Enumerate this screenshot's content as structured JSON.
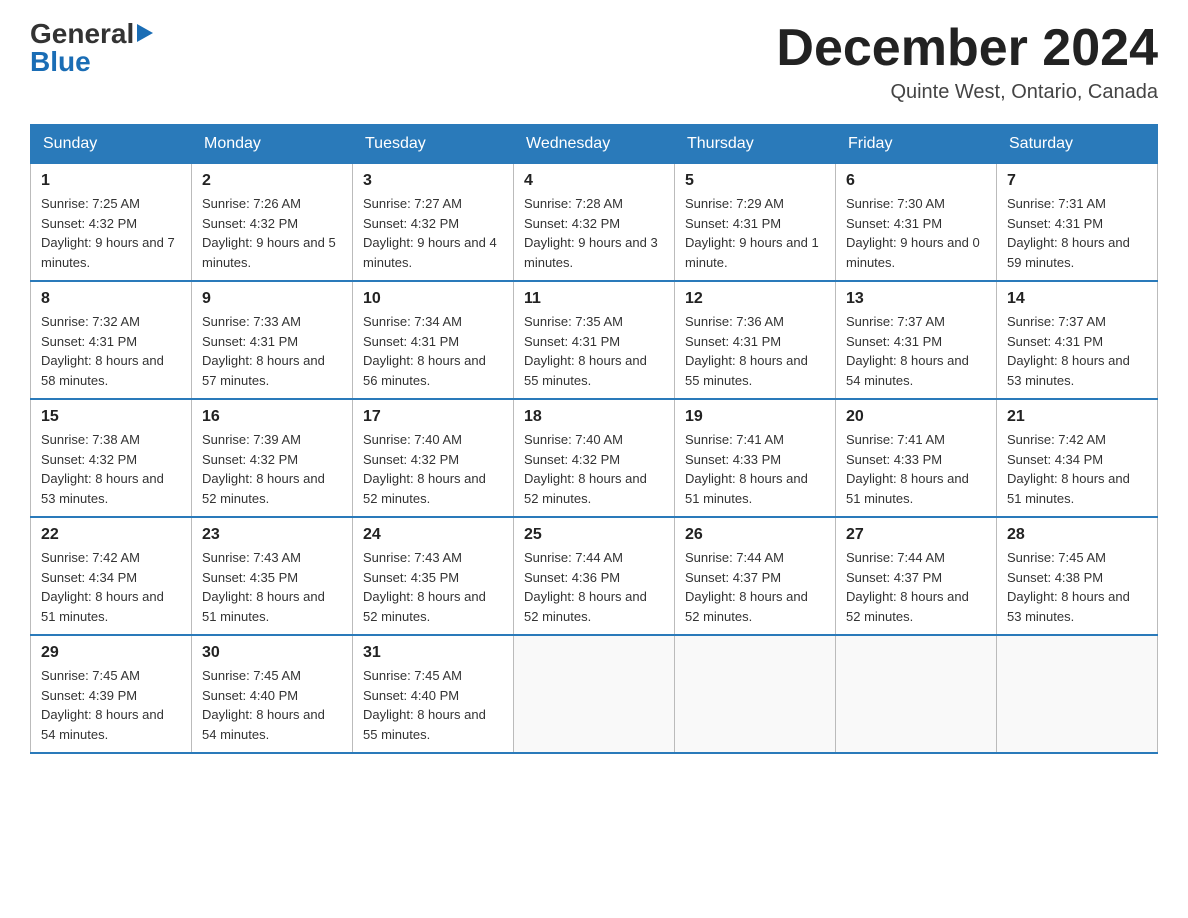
{
  "logo": {
    "general": "General",
    "triangle": "▶",
    "blue": "Blue"
  },
  "title": "December 2024",
  "subtitle": "Quinte West, Ontario, Canada",
  "days_of_week": [
    "Sunday",
    "Monday",
    "Tuesday",
    "Wednesday",
    "Thursday",
    "Friday",
    "Saturday"
  ],
  "weeks": [
    [
      {
        "day": "1",
        "sunrise": "7:25 AM",
        "sunset": "4:32 PM",
        "daylight": "9 hours and 7 minutes."
      },
      {
        "day": "2",
        "sunrise": "7:26 AM",
        "sunset": "4:32 PM",
        "daylight": "9 hours and 5 minutes."
      },
      {
        "day": "3",
        "sunrise": "7:27 AM",
        "sunset": "4:32 PM",
        "daylight": "9 hours and 4 minutes."
      },
      {
        "day": "4",
        "sunrise": "7:28 AM",
        "sunset": "4:32 PM",
        "daylight": "9 hours and 3 minutes."
      },
      {
        "day": "5",
        "sunrise": "7:29 AM",
        "sunset": "4:31 PM",
        "daylight": "9 hours and 1 minute."
      },
      {
        "day": "6",
        "sunrise": "7:30 AM",
        "sunset": "4:31 PM",
        "daylight": "9 hours and 0 minutes."
      },
      {
        "day": "7",
        "sunrise": "7:31 AM",
        "sunset": "4:31 PM",
        "daylight": "8 hours and 59 minutes."
      }
    ],
    [
      {
        "day": "8",
        "sunrise": "7:32 AM",
        "sunset": "4:31 PM",
        "daylight": "8 hours and 58 minutes."
      },
      {
        "day": "9",
        "sunrise": "7:33 AM",
        "sunset": "4:31 PM",
        "daylight": "8 hours and 57 minutes."
      },
      {
        "day": "10",
        "sunrise": "7:34 AM",
        "sunset": "4:31 PM",
        "daylight": "8 hours and 56 minutes."
      },
      {
        "day": "11",
        "sunrise": "7:35 AM",
        "sunset": "4:31 PM",
        "daylight": "8 hours and 55 minutes."
      },
      {
        "day": "12",
        "sunrise": "7:36 AM",
        "sunset": "4:31 PM",
        "daylight": "8 hours and 55 minutes."
      },
      {
        "day": "13",
        "sunrise": "7:37 AM",
        "sunset": "4:31 PM",
        "daylight": "8 hours and 54 minutes."
      },
      {
        "day": "14",
        "sunrise": "7:37 AM",
        "sunset": "4:31 PM",
        "daylight": "8 hours and 53 minutes."
      }
    ],
    [
      {
        "day": "15",
        "sunrise": "7:38 AM",
        "sunset": "4:32 PM",
        "daylight": "8 hours and 53 minutes."
      },
      {
        "day": "16",
        "sunrise": "7:39 AM",
        "sunset": "4:32 PM",
        "daylight": "8 hours and 52 minutes."
      },
      {
        "day": "17",
        "sunrise": "7:40 AM",
        "sunset": "4:32 PM",
        "daylight": "8 hours and 52 minutes."
      },
      {
        "day": "18",
        "sunrise": "7:40 AM",
        "sunset": "4:32 PM",
        "daylight": "8 hours and 52 minutes."
      },
      {
        "day": "19",
        "sunrise": "7:41 AM",
        "sunset": "4:33 PM",
        "daylight": "8 hours and 51 minutes."
      },
      {
        "day": "20",
        "sunrise": "7:41 AM",
        "sunset": "4:33 PM",
        "daylight": "8 hours and 51 minutes."
      },
      {
        "day": "21",
        "sunrise": "7:42 AM",
        "sunset": "4:34 PM",
        "daylight": "8 hours and 51 minutes."
      }
    ],
    [
      {
        "day": "22",
        "sunrise": "7:42 AM",
        "sunset": "4:34 PM",
        "daylight": "8 hours and 51 minutes."
      },
      {
        "day": "23",
        "sunrise": "7:43 AM",
        "sunset": "4:35 PM",
        "daylight": "8 hours and 51 minutes."
      },
      {
        "day": "24",
        "sunrise": "7:43 AM",
        "sunset": "4:35 PM",
        "daylight": "8 hours and 52 minutes."
      },
      {
        "day": "25",
        "sunrise": "7:44 AM",
        "sunset": "4:36 PM",
        "daylight": "8 hours and 52 minutes."
      },
      {
        "day": "26",
        "sunrise": "7:44 AM",
        "sunset": "4:37 PM",
        "daylight": "8 hours and 52 minutes."
      },
      {
        "day": "27",
        "sunrise": "7:44 AM",
        "sunset": "4:37 PM",
        "daylight": "8 hours and 52 minutes."
      },
      {
        "day": "28",
        "sunrise": "7:45 AM",
        "sunset": "4:38 PM",
        "daylight": "8 hours and 53 minutes."
      }
    ],
    [
      {
        "day": "29",
        "sunrise": "7:45 AM",
        "sunset": "4:39 PM",
        "daylight": "8 hours and 54 minutes."
      },
      {
        "day": "30",
        "sunrise": "7:45 AM",
        "sunset": "4:40 PM",
        "daylight": "8 hours and 54 minutes."
      },
      {
        "day": "31",
        "sunrise": "7:45 AM",
        "sunset": "4:40 PM",
        "daylight": "8 hours and 55 minutes."
      },
      null,
      null,
      null,
      null
    ]
  ],
  "labels": {
    "sunrise": "Sunrise:",
    "sunset": "Sunset:",
    "daylight": "Daylight:"
  }
}
